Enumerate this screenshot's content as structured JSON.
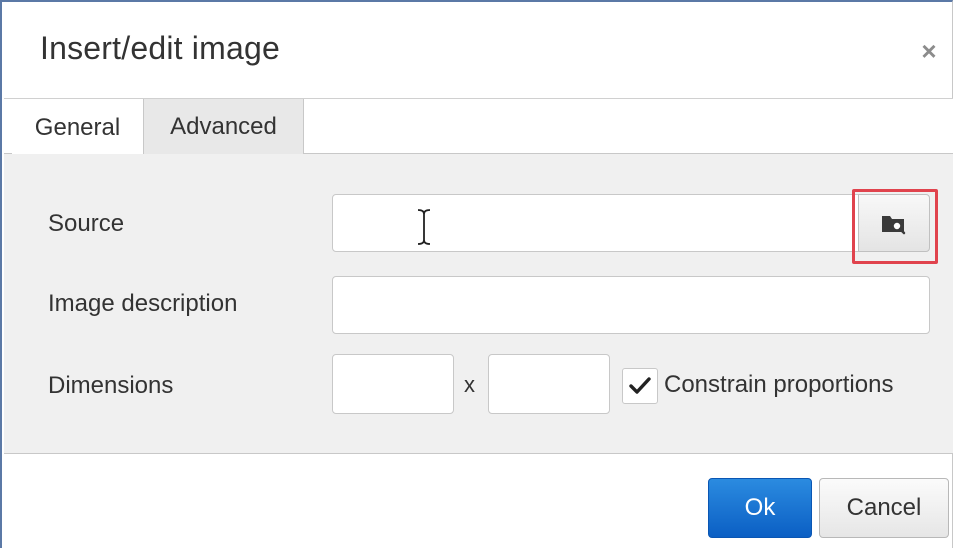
{
  "dialog": {
    "title": "Insert/edit image",
    "close_glyph": "×"
  },
  "tabs": [
    {
      "label": "General",
      "active": true
    },
    {
      "label": "Advanced",
      "active": false
    }
  ],
  "form": {
    "source": {
      "label": "Source",
      "value": "",
      "placeholder": ""
    },
    "description": {
      "label": "Image description",
      "value": "",
      "placeholder": ""
    },
    "dimensions": {
      "label": "Dimensions",
      "width": "",
      "height": "",
      "separator": "x",
      "constrain_label": "Constrain proportions",
      "constrain_checked": true
    }
  },
  "buttons": {
    "ok": "Ok",
    "cancel": "Cancel"
  },
  "icons": {
    "browse": "folder-search-icon",
    "close": "close-icon",
    "checkmark": "checkmark-icon",
    "cursor": "text-cursor-icon"
  },
  "colors": {
    "primary": "#0b5fc4",
    "highlight": "#e0434d",
    "panel_bg": "#f0f0f0"
  }
}
